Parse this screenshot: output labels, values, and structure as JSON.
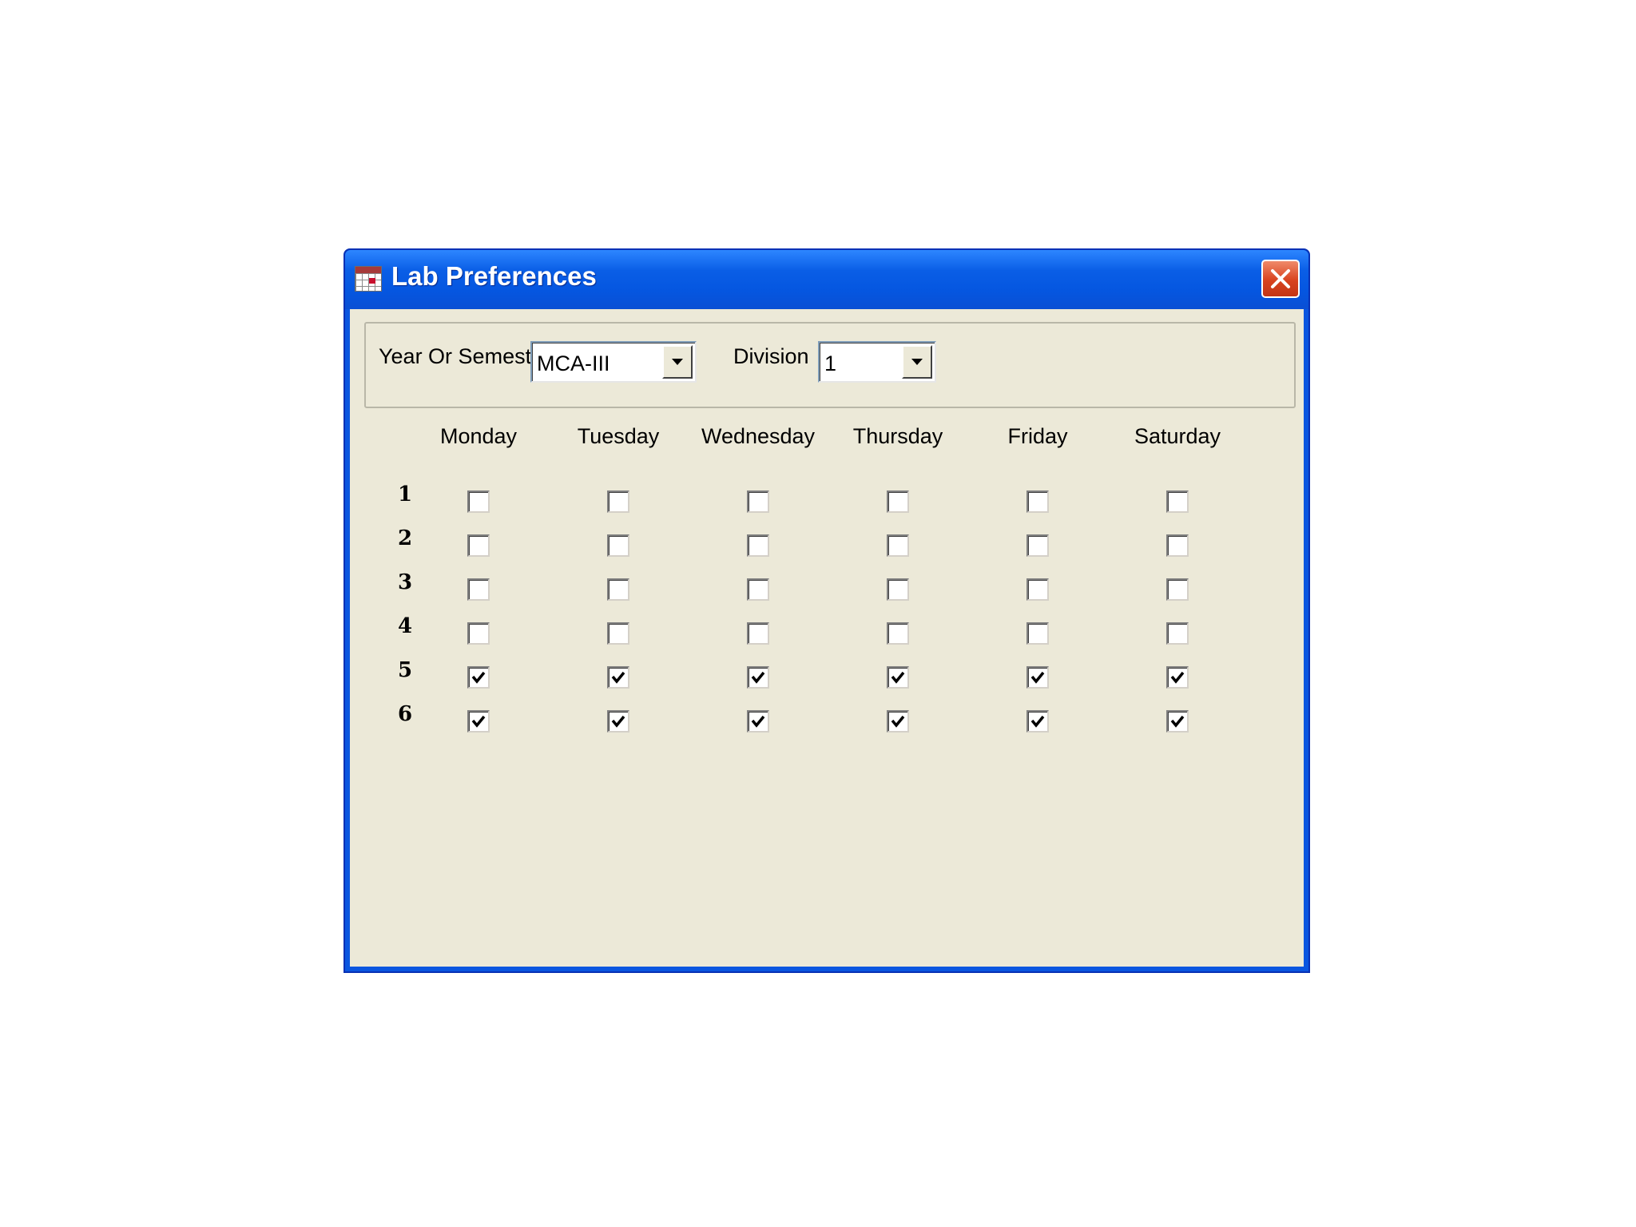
{
  "window": {
    "title": "Lab Preferences"
  },
  "filters": {
    "year_label": "Year Or Semester",
    "year_value": "MCA-III",
    "division_label": "Division",
    "division_value": "1"
  },
  "days": [
    "Monday",
    "Tuesday",
    "Wednesday",
    "Thursday",
    "Friday",
    "Saturday"
  ],
  "periods": [
    {
      "label": "1",
      "checked": [
        false,
        false,
        false,
        false,
        false,
        false
      ]
    },
    {
      "label": "2",
      "checked": [
        false,
        false,
        false,
        false,
        false,
        false
      ]
    },
    {
      "label": "3",
      "checked": [
        false,
        false,
        false,
        false,
        false,
        false
      ]
    },
    {
      "label": "4",
      "checked": [
        false,
        false,
        false,
        false,
        false,
        false
      ]
    },
    {
      "label": "5",
      "checked": [
        true,
        true,
        true,
        true,
        true,
        true
      ]
    },
    {
      "label": "6",
      "checked": [
        true,
        true,
        true,
        true,
        true,
        true
      ]
    }
  ],
  "icons": {
    "app": "calendar-icon",
    "close": "close-icon",
    "dropdown": "chevron-down-icon"
  },
  "colors": {
    "titlebar": "#0a56e0",
    "client": "#ece9d8",
    "close": "#d8421e"
  }
}
